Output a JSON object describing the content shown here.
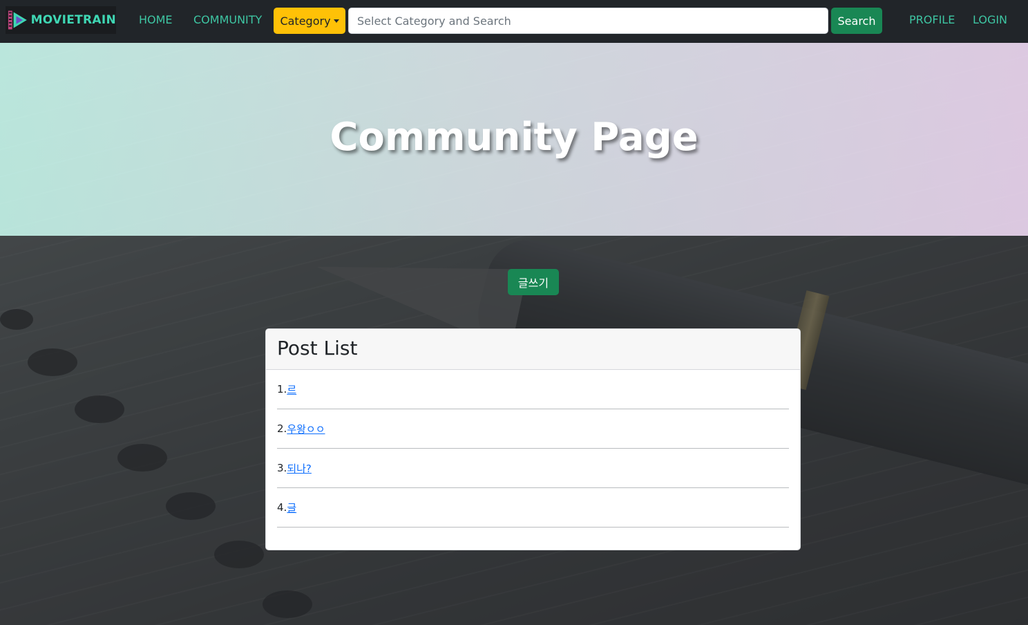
{
  "navbar": {
    "brand": "MOVIETRAIN",
    "links": {
      "home": "HOME",
      "community": "COMMUNITY",
      "profile": "PROFILE",
      "login": "LOGIN"
    },
    "category_button": "Category",
    "search_placeholder": "Select Category and Search",
    "search_value": "",
    "search_button": "Search"
  },
  "hero": {
    "title": "Community Page"
  },
  "write_button": "글쓰기",
  "post_list": {
    "title": "Post List",
    "items": [
      {
        "number": "1.",
        "title": " 르"
      },
      {
        "number": "2.",
        "title": " 우왕ㅇㅇ"
      },
      {
        "number": "3.",
        "title": " 되나?"
      },
      {
        "number": "4.",
        "title": " 글"
      }
    ]
  },
  "colors": {
    "navbar_bg": "#212529",
    "nav_link": "#3ec6a3",
    "category_button": "#ffc107",
    "success_button": "#198754",
    "link": "#0d6efd"
  },
  "icons": {
    "brand_logo": "film-play-icon",
    "dropdown": "caret-down-icon"
  }
}
